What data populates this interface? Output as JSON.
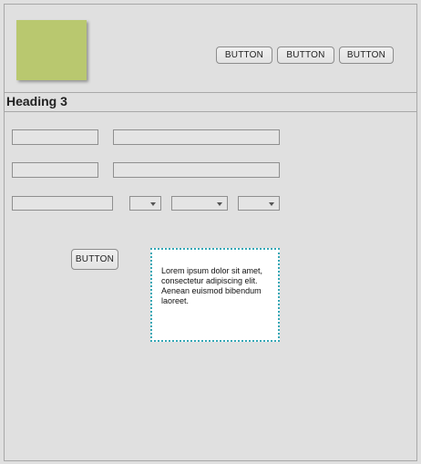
{
  "header": {
    "buttons": [
      "BUTTON",
      "BUTTON",
      "BUTTON"
    ]
  },
  "section": {
    "heading": "Heading 3"
  },
  "form": {
    "row1": {
      "field_a": "",
      "field_b": ""
    },
    "row2": {
      "field_a": "",
      "field_b": ""
    },
    "row3": {
      "field_a": "",
      "select_1": "",
      "select_2": "",
      "select_3": ""
    },
    "submit_label": "BUTTON"
  },
  "note": {
    "text": "Lorem ipsum dolor sit amet, consectetur adipiscing elit. Aenean euismod bibendum laoreet."
  },
  "colors": {
    "background": "#e0e0e0",
    "logo_fill": "#b9c86f",
    "note_border": "#35a7b5"
  }
}
